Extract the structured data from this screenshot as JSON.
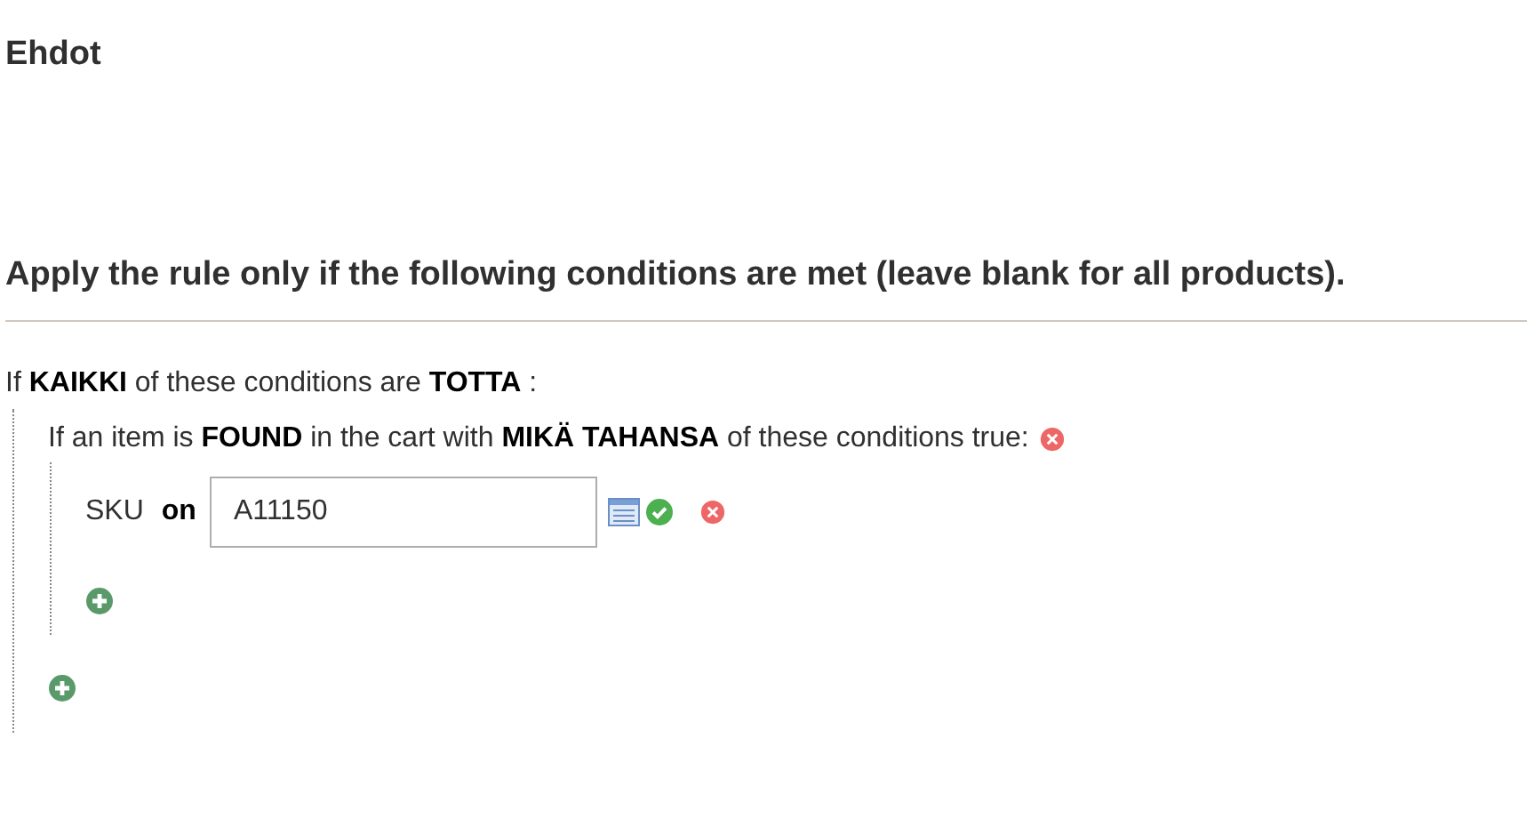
{
  "section_title": "Ehdot",
  "heading": "Apply the rule only if the following conditions are met (leave blank for all products).",
  "root_condition": "If **KAIKKI**  of these conditions are **TOTTA** :",
  "found_condition": {
    "text": "If an item is **FOUND**  in the cart with **MIKÄ TAHANSA**  of these conditions true:",
    "rows": [
      {
        "attribute": "SKU",
        "operator": "on",
        "value": "A11150"
      }
    ]
  }
}
